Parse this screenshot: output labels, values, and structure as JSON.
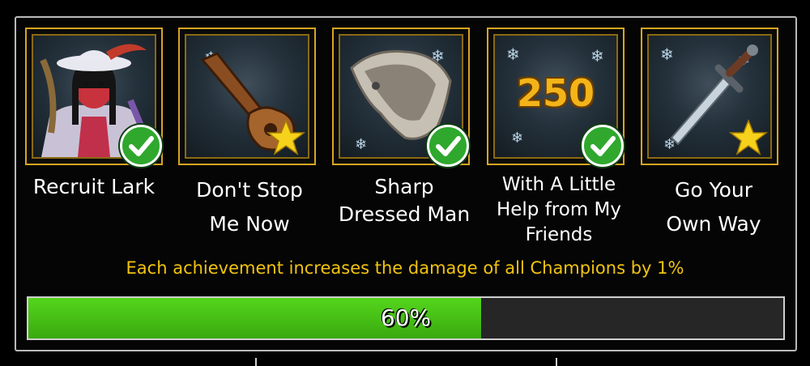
{
  "achievements": [
    {
      "name": "Recruit Lark",
      "status": "completed",
      "icon": "recruit-lark-portrait-icon"
    },
    {
      "name": "Don't Stop Me Now",
      "status": "starred",
      "icon": "guitar-icon"
    },
    {
      "name": "Sharp Dressed Man",
      "status": "completed",
      "icon": "fur-cloak-icon"
    },
    {
      "name": "With A Little Help from My Friends",
      "status": "completed",
      "icon": "number-badge-icon",
      "badge_text": "250"
    },
    {
      "name": "Go Your Own Way",
      "status": "starred",
      "icon": "dagger-icon"
    }
  ],
  "labels": {
    "a0": [
      "Recruit Lark"
    ],
    "a1": [
      "Don't Stop",
      "Me Now"
    ],
    "a2": [
      "Sharp",
      "Dressed Man"
    ],
    "a3": [
      "With A Little",
      "Help from My",
      "Friends"
    ],
    "a4": [
      "Go Your",
      "Own Way"
    ]
  },
  "info_text": "Each achievement increases the damage of all Champions by 1%",
  "progress": {
    "percent": 60,
    "label": "60%"
  },
  "colors": {
    "accent_gold": "#d7a521",
    "info_yellow": "#f1c40f",
    "progress_green": "#46c215",
    "check_green": "#2fa82d",
    "star_yellow": "#f7d21c"
  }
}
